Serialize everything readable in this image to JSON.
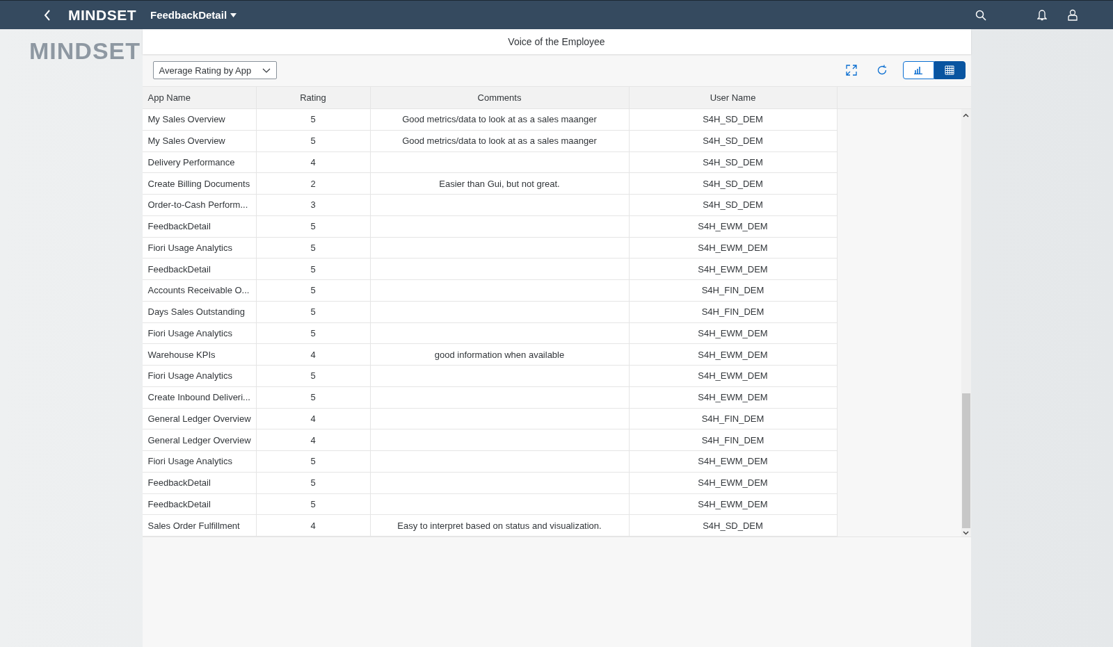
{
  "shell_bar": {
    "logo": "MINDSET",
    "app_title": "FeedbackDetail"
  },
  "side_logo": "MINDSET",
  "panel": {
    "title": "Voice of the Employee",
    "view_select": {
      "value": "Average Rating by App"
    },
    "view_toggle": [
      {
        "kind": "chart",
        "selected": false
      },
      {
        "kind": "table",
        "selected": true
      }
    ],
    "table": {
      "columns": [
        "App Name",
        "Rating",
        "Comments",
        "User Name"
      ],
      "rows": [
        [
          "My Sales Overview",
          "5",
          "Good metrics/data to look at as a sales maanger",
          "S4H_SD_DEM"
        ],
        [
          "My Sales Overview",
          "5",
          "Good metrics/data to look at as a sales maanger",
          "S4H_SD_DEM"
        ],
        [
          "Delivery Performance",
          "4",
          "",
          "S4H_SD_DEM"
        ],
        [
          "Create Billing Documents",
          "2",
          "Easier than Gui, but not great.",
          "S4H_SD_DEM"
        ],
        [
          "Order-to-Cash Perform...",
          "3",
          "",
          "S4H_SD_DEM"
        ],
        [
          "FeedbackDetail",
          "5",
          "",
          "S4H_EWM_DEM"
        ],
        [
          "Fiori Usage Analytics",
          "5",
          "",
          "S4H_EWM_DEM"
        ],
        [
          "FeedbackDetail",
          "5",
          "",
          "S4H_EWM_DEM"
        ],
        [
          "Accounts Receivable O...",
          "5",
          "",
          "S4H_FIN_DEM"
        ],
        [
          "Days Sales Outstanding",
          "5",
          "",
          "S4H_FIN_DEM"
        ],
        [
          "Fiori Usage Analytics",
          "5",
          "",
          "S4H_EWM_DEM"
        ],
        [
          "Warehouse KPIs",
          "4",
          "good information when available",
          "S4H_EWM_DEM"
        ],
        [
          "Fiori Usage Analytics",
          "5",
          "",
          "S4H_EWM_DEM"
        ],
        [
          "Create Inbound Deliveri...",
          "5",
          "",
          "S4H_EWM_DEM"
        ],
        [
          "General Ledger Overview",
          "4",
          "",
          "S4H_FIN_DEM"
        ],
        [
          "General Ledger Overview",
          "4",
          "",
          "S4H_FIN_DEM"
        ],
        [
          "Fiori Usage Analytics",
          "5",
          "",
          "S4H_EWM_DEM"
        ],
        [
          "FeedbackDetail",
          "5",
          "",
          "S4H_EWM_DEM"
        ],
        [
          "FeedbackDetail",
          "5",
          "",
          "S4H_EWM_DEM"
        ],
        [
          "Sales Order Fulfillment",
          "4",
          "Easy to interpret based on status and visualization.",
          "S4H_SD_DEM"
        ]
      ]
    }
  }
}
